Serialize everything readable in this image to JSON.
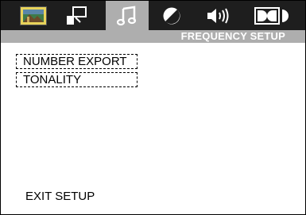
{
  "tabs": [
    {
      "icon": "picture-icon",
      "active": false
    },
    {
      "icon": "speaker-setup-icon",
      "active": false
    },
    {
      "icon": "music-note-icon",
      "active": true
    },
    {
      "icon": "contrast-circle-icon",
      "active": false
    },
    {
      "icon": "volume-icon",
      "active": false
    },
    {
      "icon": "dolby-icon",
      "active": false
    }
  ],
  "header": {
    "title": "FREQUENCY SETUP"
  },
  "menu": {
    "items": [
      "NUMBER EXPORT",
      "TONALITY"
    ]
  },
  "footer": {
    "exit_label": "EXIT SETUP"
  },
  "colors": {
    "topbar": "#1e1e1e",
    "active_tab": "#aeaeae",
    "subbar": "#aeaeae",
    "title_text": "#ffffff"
  }
}
